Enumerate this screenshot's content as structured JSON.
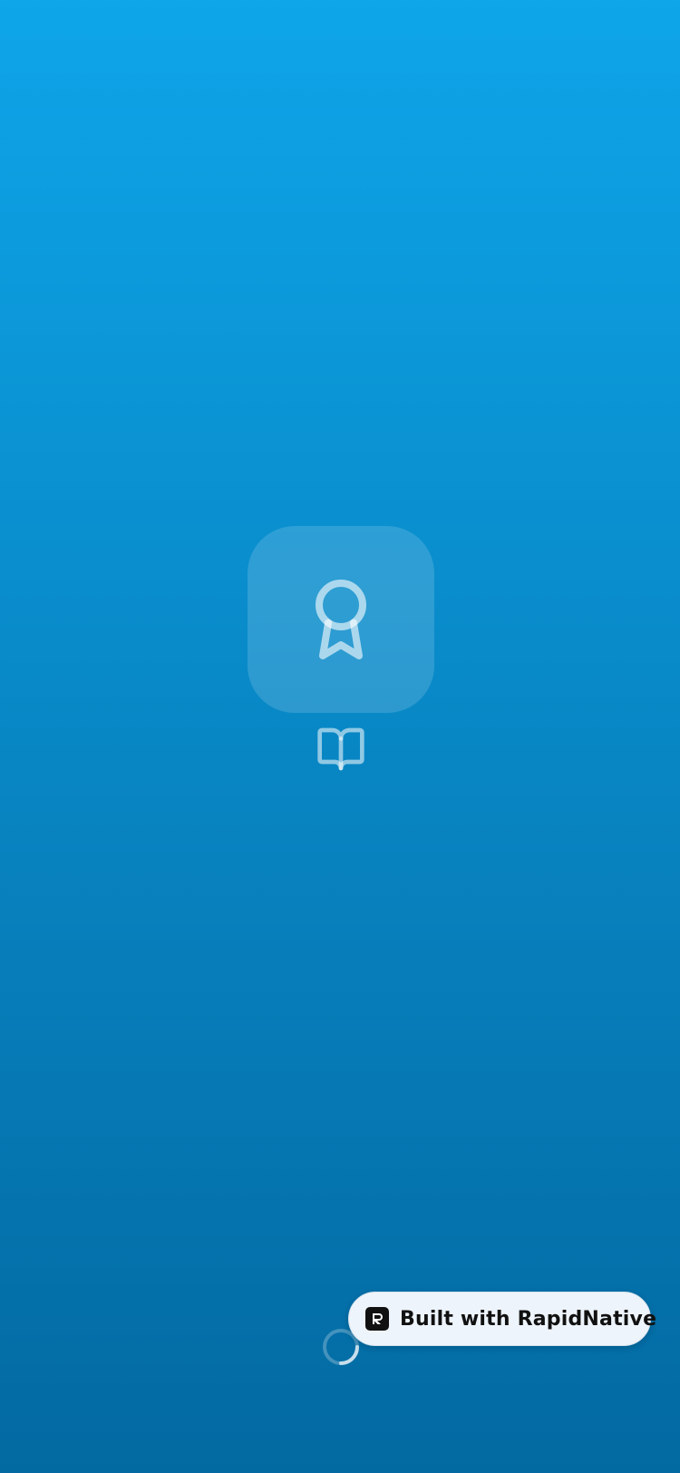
{
  "splash": {
    "background_top_color": "#0ea5e9",
    "background_bottom_color": "#0369a1",
    "logo_icon": "award-icon",
    "secondary_icon": "book-open-icon",
    "loading_indicator": "spinner-icon"
  },
  "badge": {
    "label": "Built with RapidNative",
    "icon": "rapidnative-logo-icon"
  }
}
